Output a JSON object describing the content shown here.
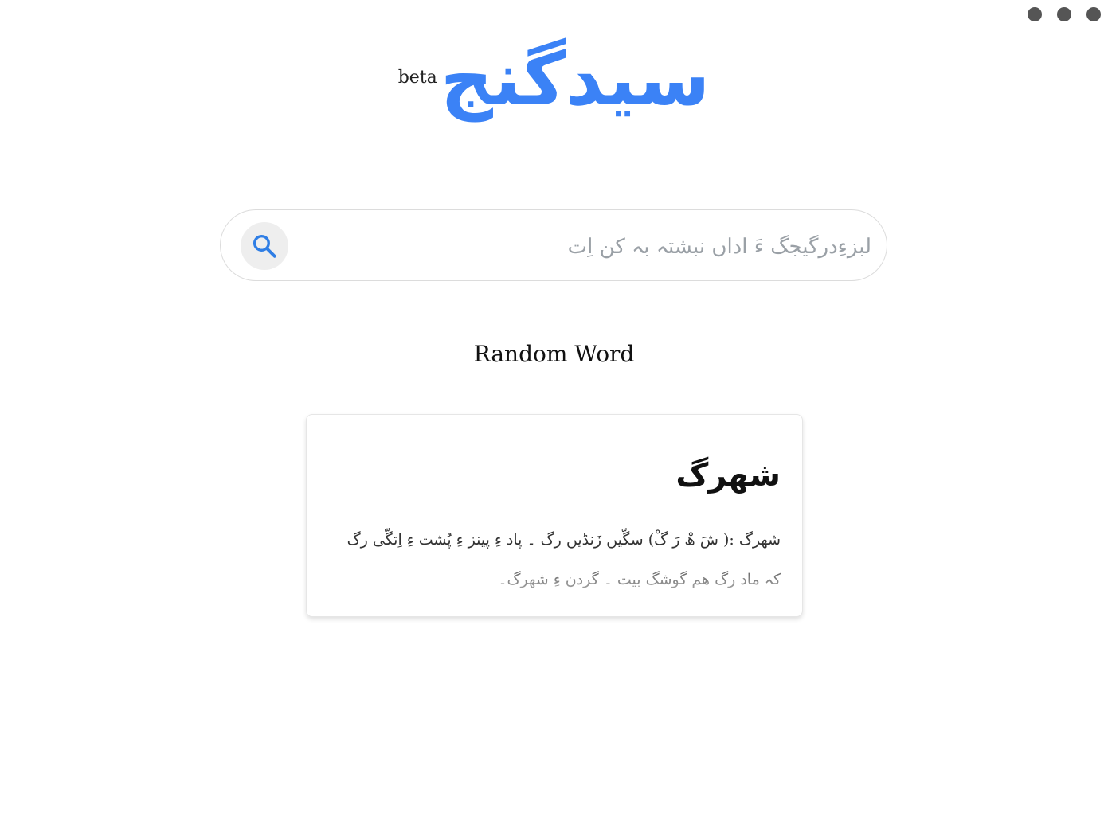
{
  "header": {
    "menu_icon": "more-dots-icon"
  },
  "logo": {
    "text": "سیدگنج",
    "badge": "beta",
    "color": "#3b82f6"
  },
  "search": {
    "placeholder": "لبزءِدرگیجگ ءَ اداں نبشتہ بہ کن اِت",
    "value": "",
    "button_icon": "search-icon",
    "icon_color": "#2f7ee5"
  },
  "random_section": {
    "title": "Random Word"
  },
  "word_card": {
    "word": "شھرگ",
    "definition": "شھرگ :( شَ ھْ رَ گْ) سگّیں زَنڈیں رگ ۔ پاد ءِ پینز ءِ پُشت ءِ اِتگّی رگ کہ ماد رگ ھم گوشگ بیت ۔ گردن ءِ شھرگ۔"
  }
}
